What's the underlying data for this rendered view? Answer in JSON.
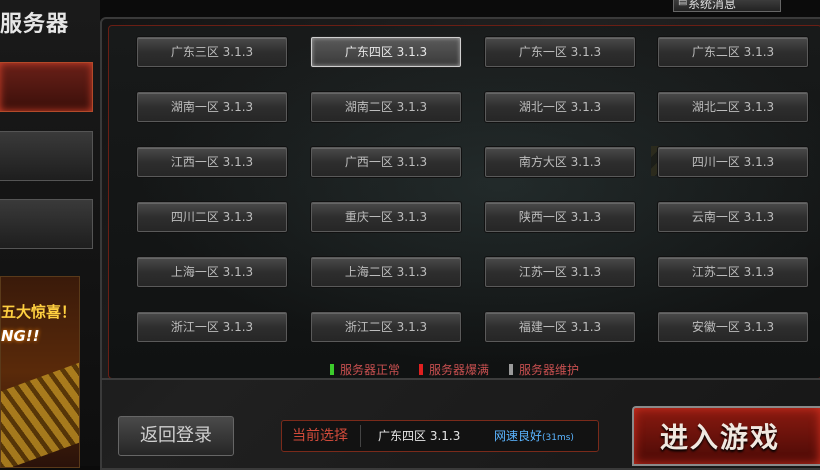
{
  "sidebar": {
    "title": "服务器",
    "promo": {
      "headline": "五大惊喜！",
      "sub": "NG!!"
    }
  },
  "header": {
    "system_message_label": "系统消息"
  },
  "servers": [
    {
      "name": "广东三区 3.1.3",
      "selected": false
    },
    {
      "name": "广东四区 3.1.3",
      "selected": true
    },
    {
      "name": "广东一区 3.1.3",
      "selected": false
    },
    {
      "name": "广东二区 3.1.3",
      "selected": false
    },
    {
      "name": "湖南一区 3.1.3",
      "selected": false
    },
    {
      "name": "湖南二区 3.1.3",
      "selected": false
    },
    {
      "name": "湖北一区 3.1.3",
      "selected": false
    },
    {
      "name": "湖北二区 3.1.3",
      "selected": false
    },
    {
      "name": "江西一区 3.1.3",
      "selected": false
    },
    {
      "name": "广西一区 3.1.3",
      "selected": false
    },
    {
      "name": "南方大区 3.1.3",
      "selected": false
    },
    {
      "name": "四川一区 3.1.3",
      "selected": false
    },
    {
      "name": "四川二区 3.1.3",
      "selected": false
    },
    {
      "name": "重庆一区 3.1.3",
      "selected": false
    },
    {
      "name": "陕西一区 3.1.3",
      "selected": false
    },
    {
      "name": "云南一区 3.1.3",
      "selected": false
    },
    {
      "name": "上海一区 3.1.3",
      "selected": false
    },
    {
      "name": "上海二区 3.1.3",
      "selected": false
    },
    {
      "name": "江苏一区 3.1.3",
      "selected": false
    },
    {
      "name": "江苏二区 3.1.3",
      "selected": false
    },
    {
      "name": "浙江一区 3.1.3",
      "selected": false
    },
    {
      "name": "浙江二区 3.1.3",
      "selected": false
    },
    {
      "name": "福建一区 3.1.3",
      "selected": false
    },
    {
      "name": "安徽一区 3.1.3",
      "selected": false
    }
  ],
  "legend": {
    "normal": {
      "label": "服务器正常",
      "color": "#3ccc2c"
    },
    "full": {
      "label": "服务器爆满",
      "color": "#e02020"
    },
    "maintenance": {
      "label": "服务器维护",
      "color": "#9a9a9a"
    }
  },
  "footer": {
    "back_label": "返回登录",
    "current_label": "当前选择",
    "current_server": "广东四区 3.1.3",
    "network_status": "网速良好",
    "ping": "(31ms)",
    "enter_label": "进入游戏"
  },
  "colors": {
    "accent_red": "#c83a2a",
    "network_blue": "#5ab4ff"
  }
}
